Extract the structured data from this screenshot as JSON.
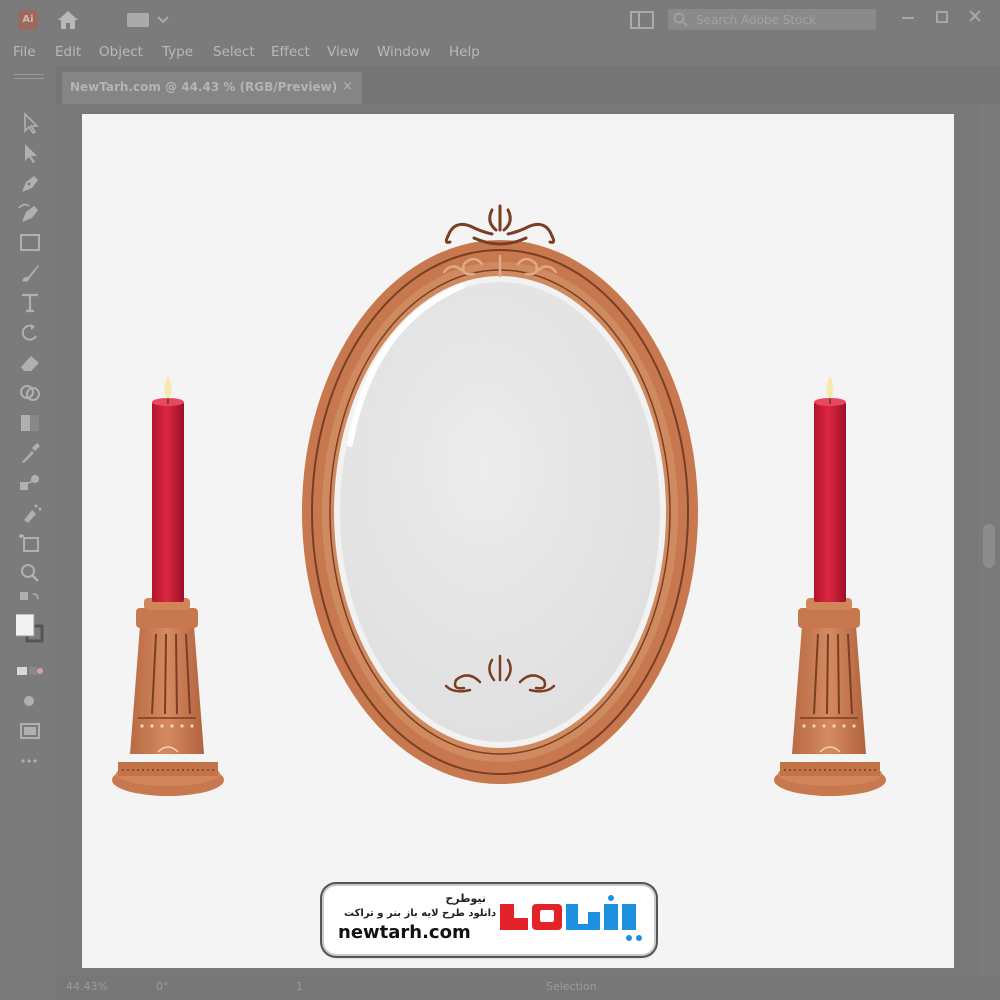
{
  "app": {
    "logo_text": "Ai",
    "search_placeholder": "Search Adobe Stock"
  },
  "menu": [
    "File",
    "Edit",
    "Object",
    "Type",
    "Select",
    "Effect",
    "View",
    "Window",
    "Help"
  ],
  "document": {
    "tab_title": "NewTarh.com @ 44.43 % (RGB/Preview)",
    "tab_close": "×"
  },
  "status": {
    "zoom": "44.43%",
    "rotation": "0°",
    "artboard_number": "1",
    "tool_name": "Selection"
  },
  "tools": [
    "selection-tool",
    "direct-selection-tool",
    "pen-tool",
    "curvature-tool",
    "rectangle-tool",
    "paintbrush-tool",
    "type-tool",
    "rotate-tool",
    "eraser-tool",
    "shape-builder-tool",
    "gradient-tool",
    "eyedropper-tool",
    "blend-tool",
    "symbol-sprayer-tool",
    "artboard-tool",
    "zoom-tool"
  ],
  "banner": {
    "brand_name_fa": "نیوطرح",
    "tagline_fa": "دانلود طرح لایه باز بنر و تراکت",
    "url": "newtarh.com",
    "logo_text_fa": "نیوطرح",
    "colors": {
      "blue": "#1e90e0",
      "red": "#e3222a"
    }
  },
  "artwork": {
    "colors": {
      "frame": "#c8784e",
      "frame_dark": "#7a3e22",
      "candle": "#d01f3a",
      "mirror": "#e8e8e8"
    }
  }
}
